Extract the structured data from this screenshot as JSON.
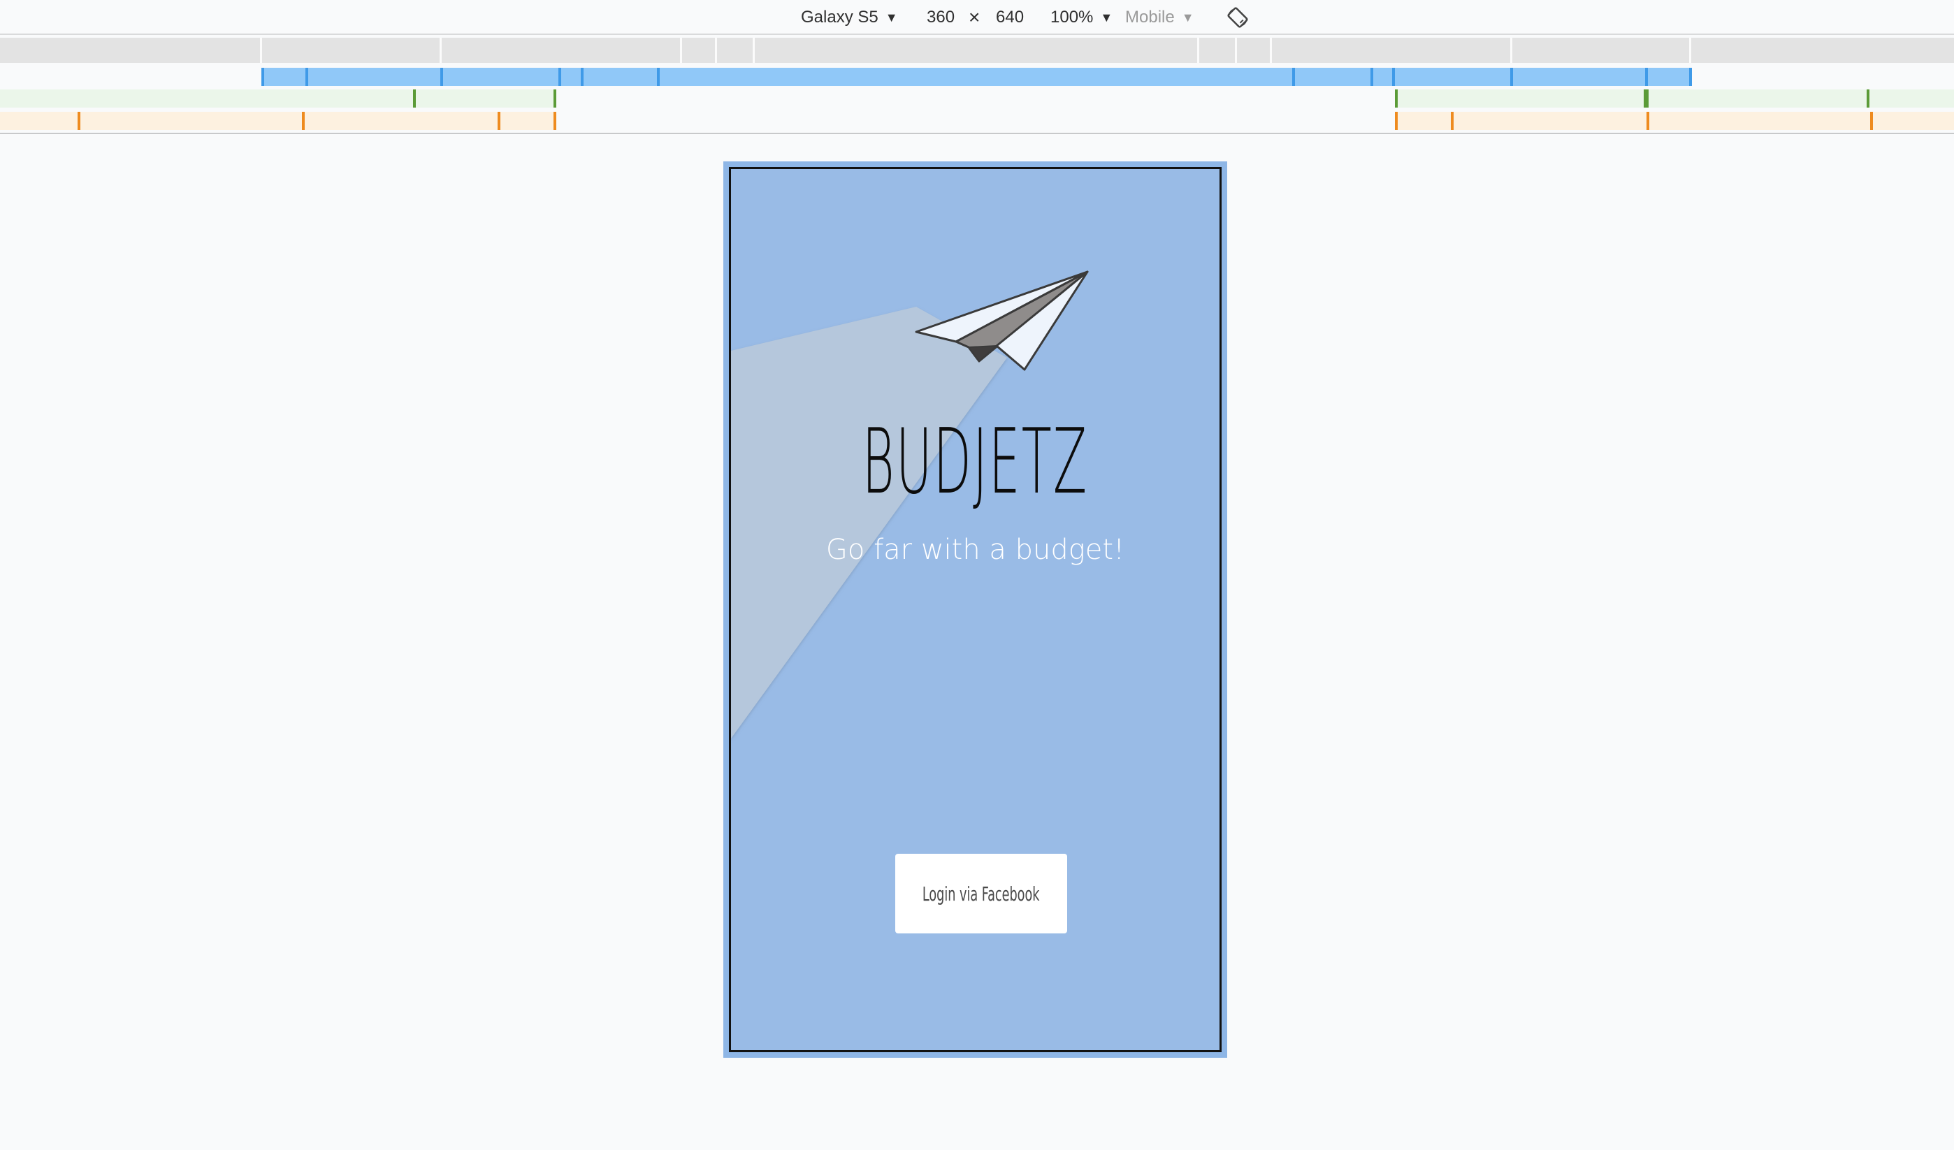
{
  "toolbar": {
    "device": "Galaxy S5",
    "width": "360",
    "times": "×",
    "height": "640",
    "zoom": "100%",
    "mode": "Mobile",
    "arrow": "▼"
  },
  "app": {
    "title": "BUDJETZ",
    "subtitle": "Go far with a budget!",
    "login_label": "Login via Facebook"
  },
  "colors": {
    "max_width_bar": "#90c8f8",
    "max_width_tick": "#3f9ae8",
    "min_width_bar": "#ebf6ea",
    "min_width_tick": "#5b9b37",
    "range_bar": "#fdf1e0",
    "range_tick": "#ee8b1f",
    "screen_bg": "#99bbe6",
    "trail": "#b5c7dc"
  }
}
